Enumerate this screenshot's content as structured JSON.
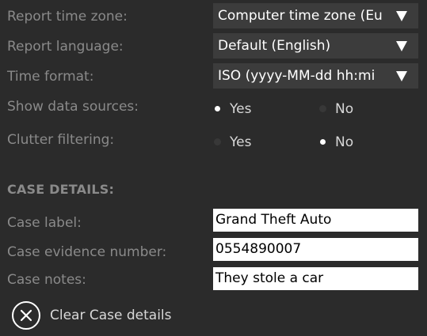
{
  "report_settings": {
    "time_zone": {
      "label": "Report time zone:",
      "value": "Computer time zone (Eu"
    },
    "language": {
      "label": "Report language:",
      "value": "Default (English)"
    },
    "time_format": {
      "label": "Time format:",
      "value": "ISO (yyyy-MM-dd hh:mi"
    },
    "show_data_sources": {
      "label": "Show data sources:",
      "options": [
        "Yes",
        "No"
      ],
      "selected": "Yes"
    },
    "clutter_filtering": {
      "label": "Clutter filtering:",
      "options": [
        "Yes",
        "No"
      ],
      "selected": "No"
    }
  },
  "case_details": {
    "title": "CASE DETAILS:",
    "case_label": {
      "label": "Case label:",
      "value": "Grand Theft Auto"
    },
    "evidence_number": {
      "label": "Case evidence number:",
      "value": "0554890007"
    },
    "notes": {
      "label": "Case notes:",
      "value": "They stole a car"
    },
    "clear_button": {
      "label": "Clear Case details",
      "icon": "close-circle-icon"
    }
  },
  "colors": {
    "background": "#2b2b2b",
    "dropdown_background": "#3c3c3c",
    "label_text": "#8a8a8a",
    "value_text": "#ffffff"
  }
}
